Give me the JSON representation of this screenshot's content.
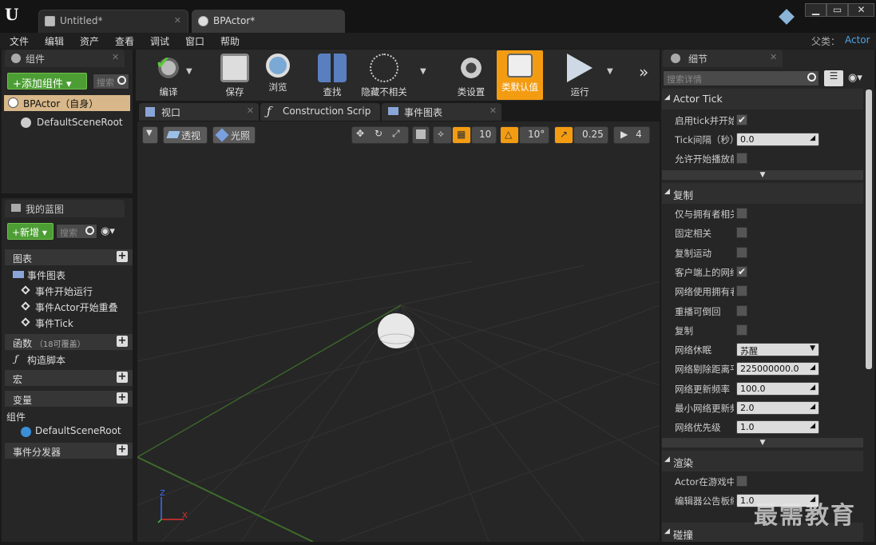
{
  "titlebar": {
    "tabs": [
      {
        "label": "Untitled*"
      },
      {
        "label": "BPActor*"
      }
    ],
    "logo": "unreal-logo-icon"
  },
  "menu": {
    "items": [
      "文件",
      "编辑",
      "资产",
      "查看",
      "调试",
      "窗口",
      "帮助"
    ],
    "parent_label": "父类：",
    "parent_value": "Actor"
  },
  "components_panel": {
    "title": "组件",
    "add_button": "+添加组件",
    "search_placeholder": "搜索",
    "items": [
      "BPActor（自身）",
      "DefaultSceneRoot"
    ]
  },
  "my_blueprint": {
    "title": "我的蓝图",
    "new_button": "+新增",
    "search_placeholder": "搜索",
    "sections": {
      "graphs": "图表",
      "event_graph": "事件图表",
      "events": [
        "事件开始运行",
        "事件Actor开始重叠",
        "事件Tick"
      ],
      "functions": "函数",
      "functions_note": "（18可覆盖）",
      "construction": "构造脚本",
      "macros": "宏",
      "variables": "变量",
      "components": "组件",
      "component_item": "DefaultSceneRoot",
      "dispatchers": "事件分发器"
    }
  },
  "toolbar": {
    "buttons": [
      "编译",
      "保存",
      "浏览",
      "查找",
      "隐藏不相关",
      "类设置",
      "类默认值",
      "运行"
    ]
  },
  "viewport_tabs": [
    "视口",
    "Construction Scrip",
    "事件图表"
  ],
  "viewport": {
    "perspective": "透视",
    "lit": "光照",
    "grid_value": "10",
    "rot_value": "10°",
    "scale_value": "0.25",
    "cam_speed": "4",
    "axis_x": "X",
    "axis_z": "Z"
  },
  "details": {
    "title": "细节",
    "search_placeholder": "搜索详情",
    "sections": {
      "actor_tick": "Actor Tick",
      "replication": "复制",
      "rendering": "渲染",
      "collision": "碰撞"
    },
    "tick": [
      {
        "label": "启用tick并开始",
        "type": "check",
        "checked": true
      },
      {
        "label": "Tick间隔（秒）",
        "type": "field",
        "value": "0.0"
      },
      {
        "label": "允许开始播放前",
        "type": "check",
        "checked": false
      }
    ],
    "repl": [
      {
        "label": "仅与拥有者相关",
        "type": "check",
        "checked": false
      },
      {
        "label": "固定相关",
        "type": "check",
        "checked": false
      },
      {
        "label": "复制运动",
        "type": "check",
        "checked": false
      },
      {
        "label": "客户端上的网络",
        "type": "check",
        "checked": true
      },
      {
        "label": "网络使用拥有者",
        "type": "check",
        "checked": false
      },
      {
        "label": "重播可倒回",
        "type": "check",
        "checked": false
      },
      {
        "label": "复制",
        "type": "check",
        "checked": false
      },
      {
        "label": "网络休眠",
        "type": "select",
        "value": "苏醒"
      },
      {
        "label": "网络剔除距离平方",
        "type": "field",
        "value": "225000000.0"
      },
      {
        "label": "网络更新频率",
        "type": "field",
        "value": "100.0"
      },
      {
        "label": "最小网络更新频率",
        "type": "field",
        "value": "2.0"
      },
      {
        "label": "网络优先级",
        "type": "field",
        "value": "1.0"
      }
    ],
    "render": [
      {
        "label": "Actor在游戏中隐藏",
        "type": "check",
        "checked": false
      },
      {
        "label": "编辑器公告板缩放",
        "type": "field",
        "value": "1.0"
      }
    ]
  },
  "watermark": "最需教育",
  "colors": {
    "accent": "#f39c12",
    "green": "#4c9e34",
    "link": "#4fa3e0"
  }
}
